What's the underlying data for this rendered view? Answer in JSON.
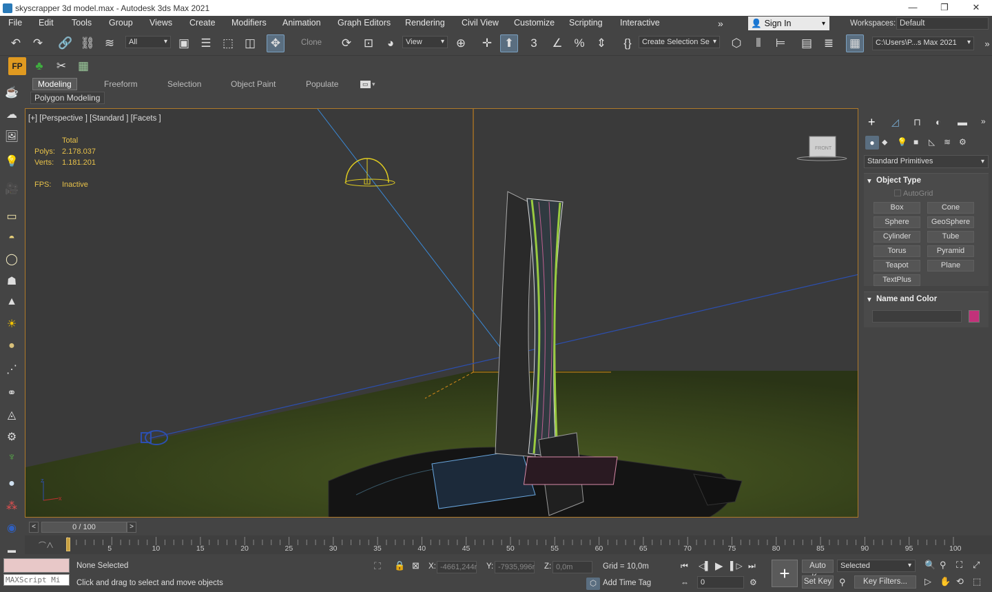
{
  "window": {
    "title": "skyscrapper 3d model.max - Autodesk 3ds Max 2021",
    "controls": [
      "—",
      "❐",
      "✕"
    ]
  },
  "menu": [
    "File",
    "Edit",
    "Tools",
    "Group",
    "Views",
    "Create",
    "Modifiers",
    "Animation",
    "Graph Editors",
    "Rendering",
    "Civil View",
    "Customize",
    "Scripting",
    "Interactive"
  ],
  "signin": {
    "label": "Sign In"
  },
  "workspaces": {
    "label": "Workspaces:",
    "value": "Default"
  },
  "toolbar": {
    "filter_value": "All",
    "clone_label": "Clone",
    "ref_coord_value": "View",
    "selection_set_value": "Create Selection Se",
    "project_path": "C:\\Users\\P...s Max 2021"
  },
  "ribbon": {
    "tabs": [
      "Modeling",
      "Freeform",
      "Selection",
      "Object Paint",
      "Populate"
    ],
    "active_tab": "Modeling",
    "panel_label": "Polygon Modeling"
  },
  "viewport": {
    "label": "[+] [Perspective ] [Standard ] [Facets ]",
    "stats": {
      "header": "Total",
      "polys_label": "Polys:",
      "polys_value": "2.178.037",
      "verts_label": "Verts:",
      "verts_value": "1.181.201",
      "fps_label": "FPS:",
      "fps_value": "Inactive"
    },
    "viewcube_label": "FRONT"
  },
  "command_panel": {
    "dropdown_value": "Standard Primitives",
    "object_type": {
      "title": "Object Type",
      "autogrid": "AutoGrid",
      "buttons": [
        "Box",
        "Cone",
        "Sphere",
        "GeoSphere",
        "Cylinder",
        "Tube",
        "Torus",
        "Pyramid",
        "Teapot",
        "Plane",
        "TextPlus"
      ]
    },
    "name_color": {
      "title": "Name and Color",
      "name_value": "",
      "swatch_color": "#c2327a"
    }
  },
  "timeline": {
    "frame_display": "0 / 100",
    "ticks": [
      "5",
      "10",
      "15",
      "20",
      "25",
      "30",
      "35",
      "40",
      "45",
      "50",
      "55",
      "60",
      "65",
      "70",
      "75",
      "80",
      "85",
      "90",
      "95",
      "100"
    ]
  },
  "status": {
    "maxscript_placeholder": "MAXScript Mi",
    "selection_text": "None Selected",
    "prompt_text": "Click and drag to select and move objects",
    "x_label": "X:",
    "x_value": "-4661,244r",
    "y_label": "Y:",
    "y_value": "-7935,996r",
    "z_label": "Z:",
    "z_value": "0,0m",
    "grid_text": "Grid = 10,0m",
    "add_time_tag": "Add Time Tag",
    "auto_key": "Auto K...",
    "set_key": "Set Key",
    "key_mode_value": "Selected",
    "key_filters": "Key Filters...",
    "frame_value": "0"
  },
  "colors": {
    "viewport_border": "#b07a2a",
    "stats_text": "#e8c24a",
    "accent": "#5a6e80"
  }
}
